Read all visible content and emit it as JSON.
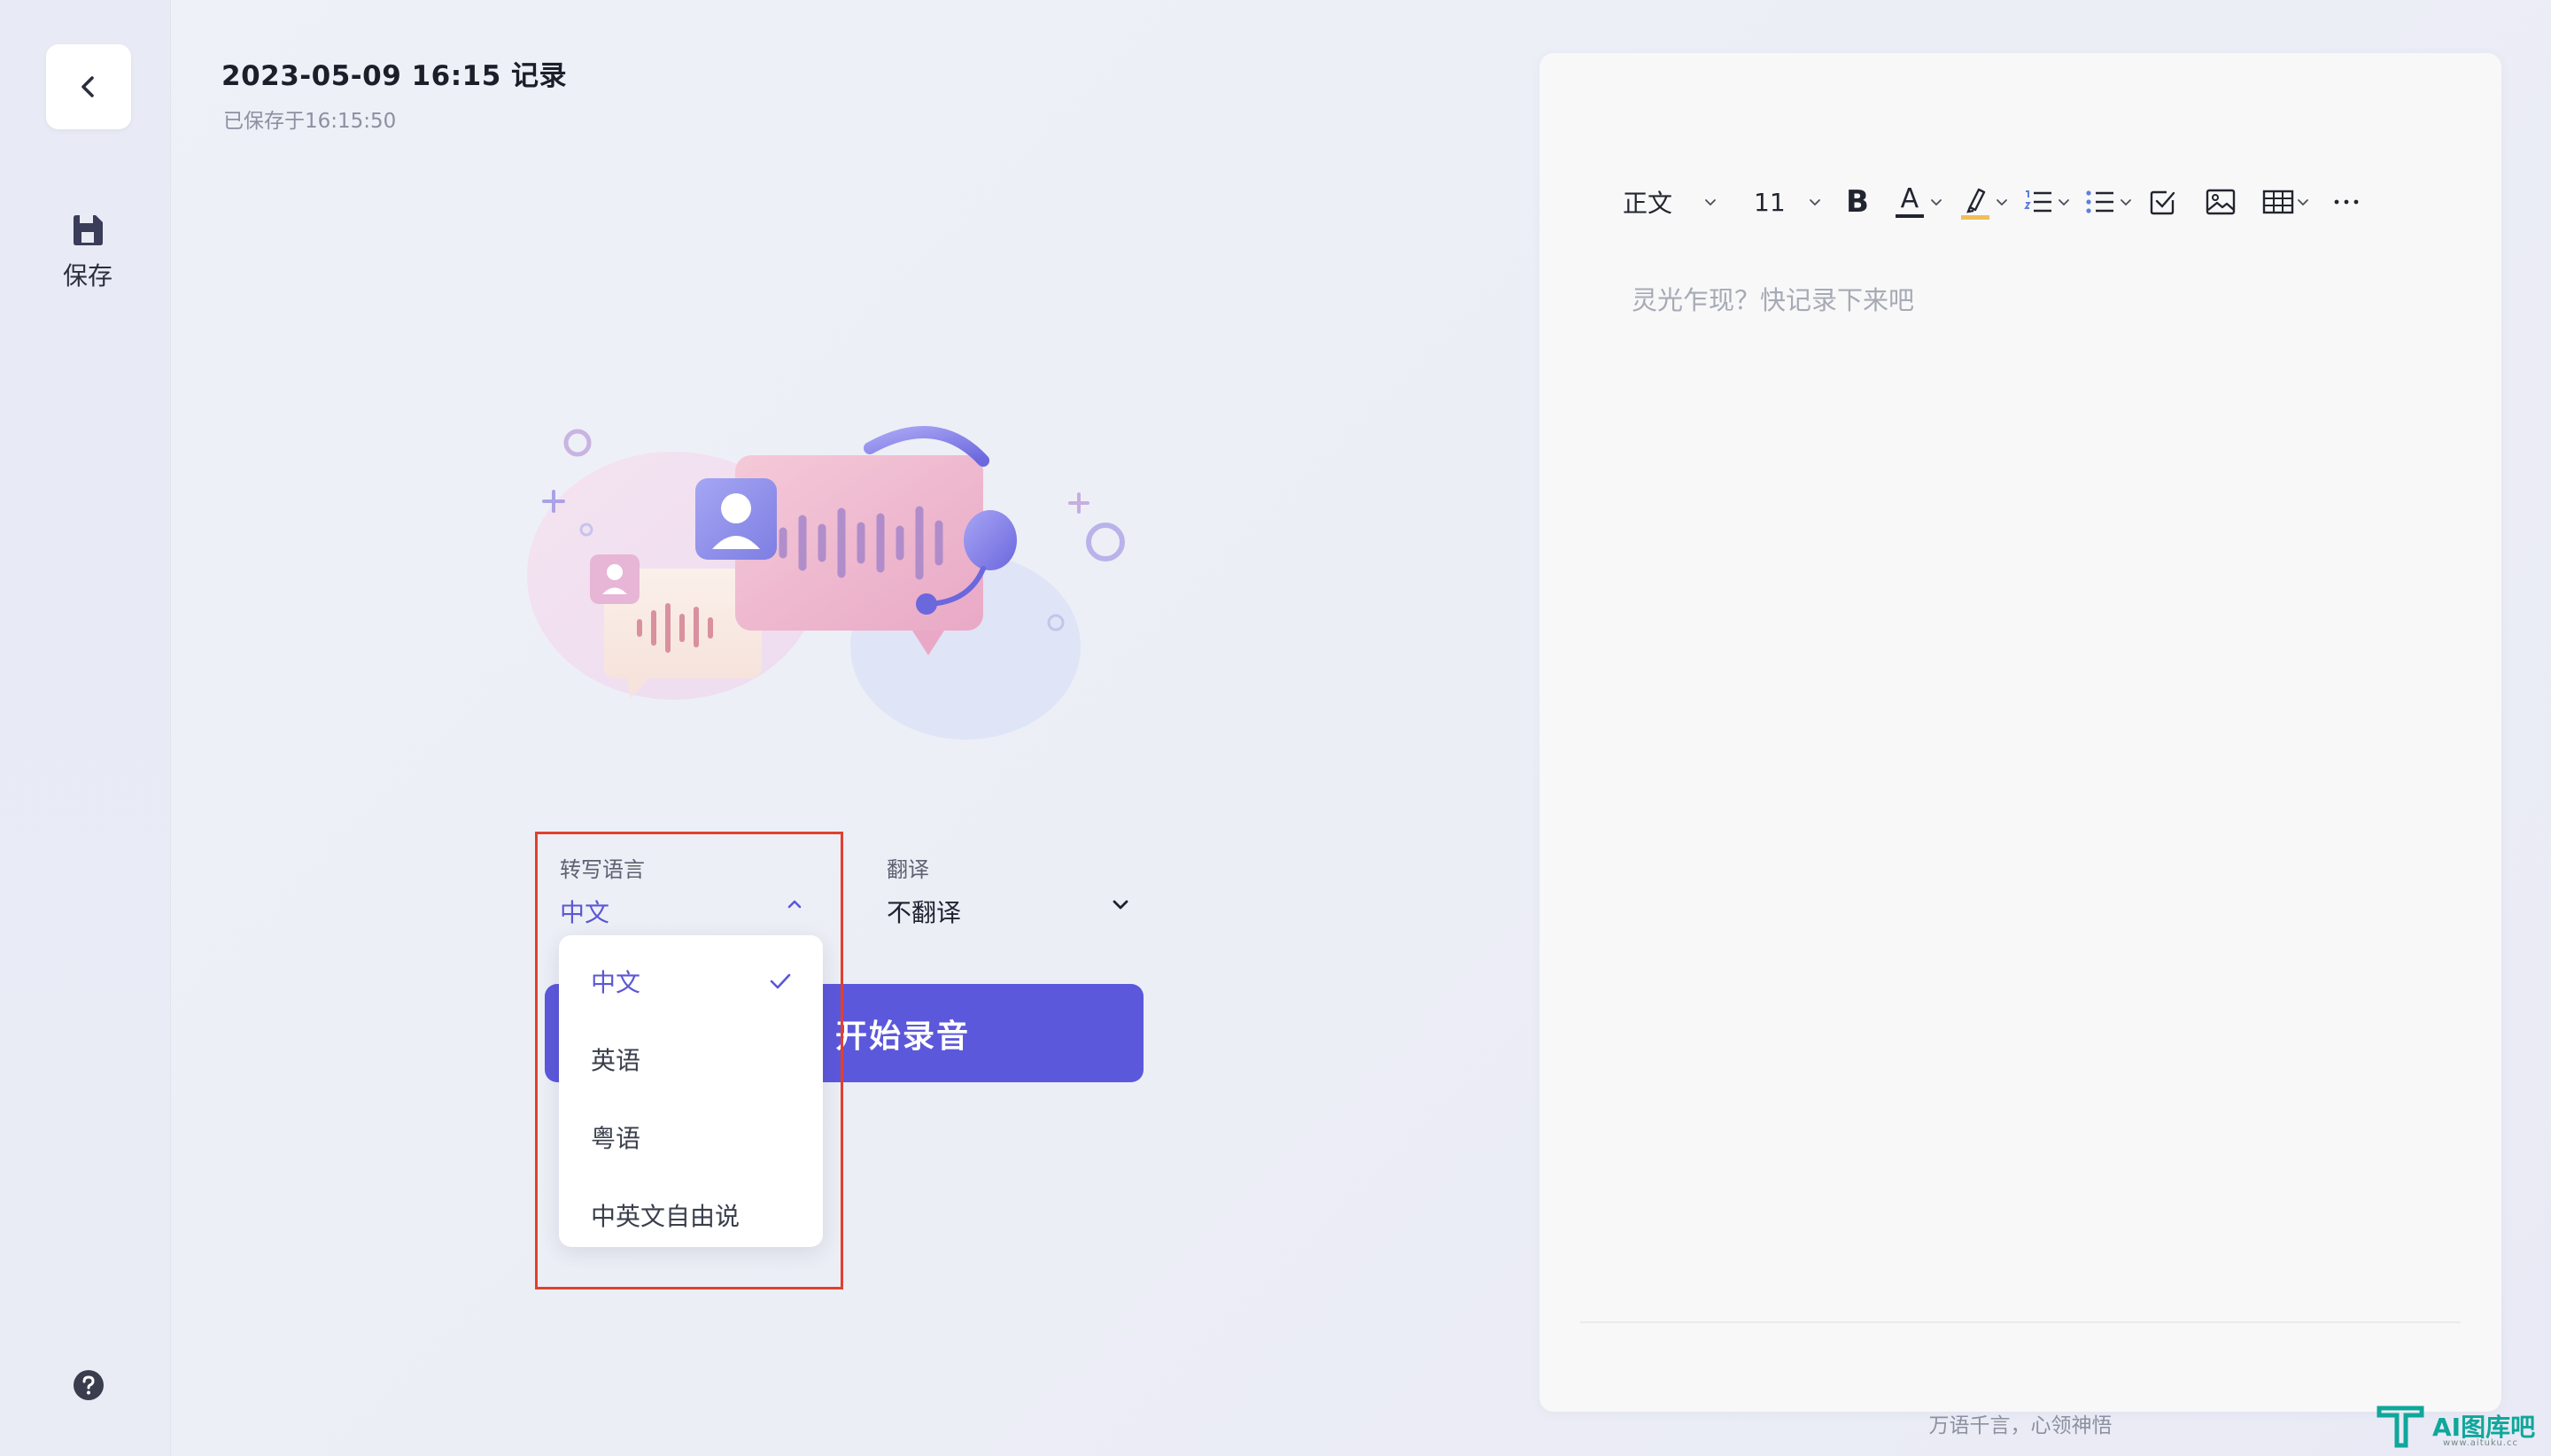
{
  "sidebar": {
    "save_label": "保存"
  },
  "header": {
    "title": "2023-05-09 16:15 记录",
    "saved_at": "已保存于16:15:50"
  },
  "transcription": {
    "label": "转写语言",
    "value": "中文",
    "options": [
      {
        "label": "中文",
        "selected": true
      },
      {
        "label": "英语",
        "selected": false
      },
      {
        "label": "粤语",
        "selected": false
      },
      {
        "label": "中英文自由说",
        "selected": false
      }
    ]
  },
  "translation": {
    "label": "翻译",
    "value": "不翻译"
  },
  "record_button": {
    "label": "开始录音",
    "visible_text": "始录音"
  },
  "editor": {
    "toolbar": {
      "style": "正文",
      "font_size": "11",
      "bold": "B",
      "font_color": "A"
    },
    "placeholder": "灵光乍现？快记录下来吧",
    "footer": "万语千言，心领神悟"
  },
  "watermark": {
    "text": "AI图库吧",
    "sub": "www.aituku.cc"
  },
  "colors": {
    "accent": "#5c58db",
    "highlight_frame": "#e0412f"
  }
}
